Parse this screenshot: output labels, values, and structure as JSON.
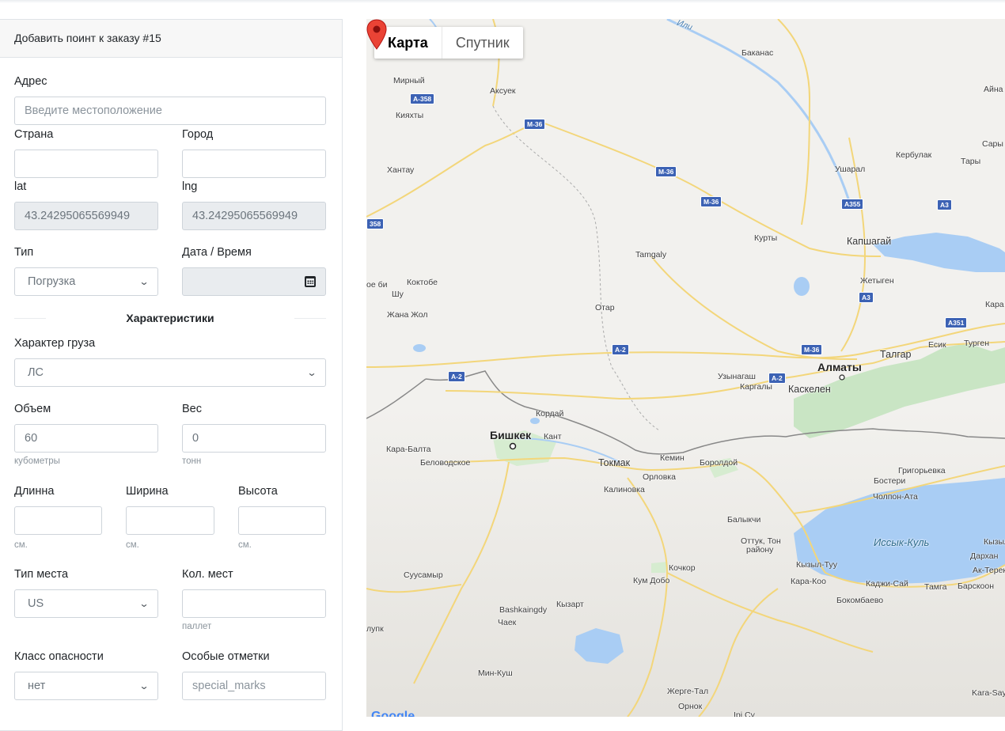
{
  "form": {
    "title": "Добавить поинт к заказу #15",
    "address": {
      "label": "Адрес",
      "placeholder": "Введите местоположение",
      "value": ""
    },
    "country": {
      "label": "Страна",
      "value": ""
    },
    "city": {
      "label": "Город",
      "value": ""
    },
    "lat": {
      "label": "lat",
      "value": "43.24295065569949"
    },
    "lng": {
      "label": "lng",
      "value": "43.24295065569949"
    },
    "type": {
      "label": "Тип",
      "value": "Погрузка"
    },
    "datetime": {
      "label": "Дата / Время",
      "value": ""
    },
    "section_title": "Характеристики",
    "cargo_nature": {
      "label": "Характер груза",
      "value": "ЛС"
    },
    "volume": {
      "label": "Объем",
      "value": "60",
      "unit": "кубометры"
    },
    "weight": {
      "label": "Вес",
      "value": "0",
      "unit": "тонн"
    },
    "length": {
      "label": "Длинна",
      "value": "",
      "unit": "см."
    },
    "width": {
      "label": "Ширина",
      "value": "",
      "unit": "см."
    },
    "height": {
      "label": "Высота",
      "value": "",
      "unit": "см."
    },
    "place_type": {
      "label": "Тип места",
      "value": "US"
    },
    "place_count": {
      "label": "Кол. мест",
      "value": "",
      "unit": "паллет"
    },
    "hazard_class": {
      "label": "Класс опасности",
      "value": "нет"
    },
    "special_marks": {
      "label": "Особые отметки",
      "placeholder": "special_marks",
      "value": ""
    }
  },
  "map": {
    "type_buttons": {
      "map": "Карта",
      "satellite": "Спутник",
      "active": "map"
    },
    "logo": "Google",
    "places": {
      "ili": "Или",
      "bakanas": "Баканас",
      "aina": "Айна",
      "mirny": "Мирный",
      "aksuek": "Аксуек",
      "kiyakhty": "Кияхты",
      "kerbulak": "Кербулак",
      "saryo": "Сары",
      "tary": "Тары",
      "khantau": "Хантау",
      "usharal": "Ушарал",
      "kurty": "Курты",
      "kapshagai": "Капшагай",
      "tamgaly": "Tamgaly",
      "zhetygen": "Жетыген",
      "kokkbi": "Коктобе",
      "obi": "ое би",
      "shu": "Шу",
      "zhanazhol": "Жана Жол",
      "otar": "Отар",
      "kara": "Кара",
      "esik": "Есик",
      "turgen": "Турген",
      "talgar": "Талгар",
      "almaty": "Алматы",
      "uzynagash": "Узынагаш",
      "kargaly": "Каргалы",
      "kaskelen": "Каскелен",
      "kordai": "Кордай",
      "bishkek": "Бишкек",
      "kant": "Кант",
      "karabalta": "Кара-Балта",
      "belovodskoe": "Беловодское",
      "tokmak": "Токмак",
      "kemin": "Кемин",
      "borold": "Боролдой",
      "grigor": "Григорьевка",
      "orlovka": "Орловка",
      "kalinovka": "Калиновка",
      "bosteri": "Бостери",
      "cholpon": "Чолпон-Ата",
      "balykchy": "Балыкчи",
      "issyk": "Иссык-Куль",
      "ottuk": "Оттук, Тон",
      "raionu": "району",
      "kyzyl": "Кызыл",
      "darkhan": "Дархан",
      "akterek": "Ак-Терек",
      "kyzyltuu": "Кызыл-Туу",
      "karakoo": "Кара-Коо",
      "kadzhisai": "Каджи-Сай",
      "tamga": "Тамга",
      "barskoon": "Барскоон",
      "bokonbaevo": "Бокомбаево",
      "suusamyr": "Суусамыр",
      "kochkor": "Кочкор",
      "kumdobo": "Кум Добо",
      "bashkaingdy": "Bashkaingdy",
      "kyzart": "Кызарт",
      "chaek": "Чаек",
      "lupk": "лупк",
      "minkush": "Мин-Куш",
      "zhergetal": "Жерге-Тал",
      "ornok": "Орнок",
      "irisu": "Ірі Су",
      "karasay": "Kara-Say"
    },
    "shields": [
      "A-358",
      "M-36",
      "M-36",
      "M-36",
      "A355",
      "A3",
      "358",
      "A3",
      "A351",
      "M-36",
      "A-2",
      "A-2",
      "A-2"
    ]
  }
}
